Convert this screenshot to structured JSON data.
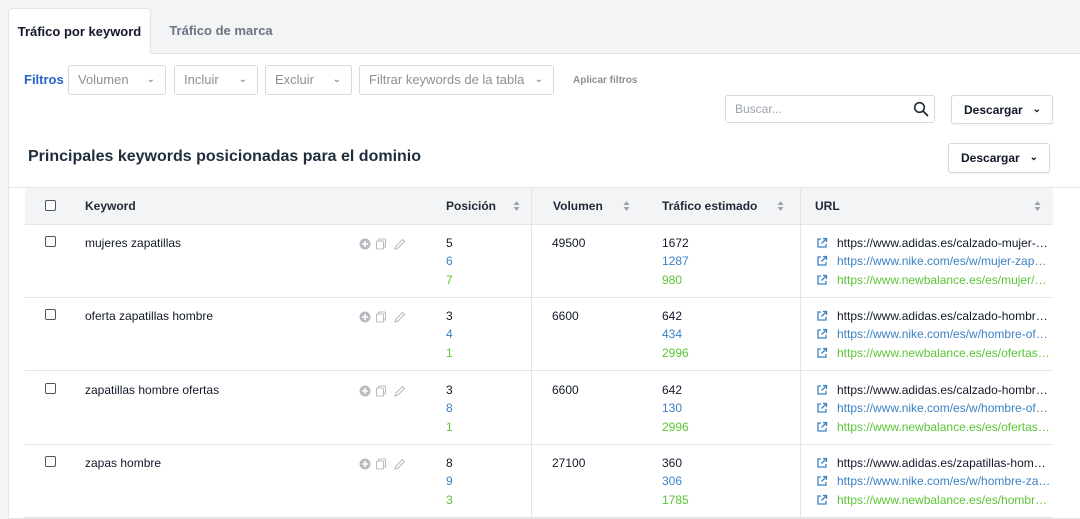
{
  "tabs": [
    {
      "label": "Tráfico por keyword",
      "active": true
    },
    {
      "label": "Tráfico de marca",
      "active": false
    }
  ],
  "filters": {
    "label": "Filtros",
    "selects": [
      "Volumen",
      "Incluir",
      "Excluir",
      "Filtrar keywords de la tabla"
    ],
    "apply": "Aplicar filtros"
  },
  "search": {
    "placeholder": "Buscar..."
  },
  "download": {
    "top": "Descargar",
    "section": "Descargar"
  },
  "section_title": "Principales keywords posicionadas para el dominio",
  "table": {
    "columns": {
      "keyword": "Keyword",
      "position": "Posición",
      "volume": "Volumen",
      "traffic": "Tráfico estimado",
      "url": "URL"
    },
    "rows": [
      {
        "keyword": "mujeres zapatillas",
        "positions": [
          "5",
          "6",
          "7"
        ],
        "volume": "49500",
        "traffic": [
          "1672",
          "1287",
          "980"
        ],
        "urls": [
          "https://www.adidas.es/calzado-mujer-zapatillas",
          "https://www.nike.com/es/w/mujer-zapatillas",
          "https://www.newbalance.es/es/mujer/zapatillas"
        ]
      },
      {
        "keyword": "oferta zapatillas hombre",
        "positions": [
          "3",
          "4",
          "1"
        ],
        "volume": "6600",
        "traffic": [
          "642",
          "434",
          "2996"
        ],
        "urls": [
          "https://www.adidas.es/calzado-hombre-ofertas",
          "https://www.nike.com/es/w/hombre-ofertas-zapatillas",
          "https://www.newbalance.es/es/ofertas/hombre"
        ]
      },
      {
        "keyword": "zapatillas hombre ofertas",
        "positions": [
          "3",
          "8",
          "1"
        ],
        "volume": "6600",
        "traffic": [
          "642",
          "130",
          "2996"
        ],
        "urls": [
          "https://www.adidas.es/calzado-hombre-ofertas",
          "https://www.nike.com/es/w/hombre-ofertas-zapatillas",
          "https://www.newbalance.es/es/ofertas/hombre"
        ]
      },
      {
        "keyword": "zapas hombre",
        "positions": [
          "8",
          "9",
          "3"
        ],
        "volume": "27100",
        "traffic": [
          "360",
          "306",
          "1785"
        ],
        "urls": [
          "https://www.adidas.es/zapatillas-hombre",
          "https://www.nike.com/es/w/hombre-zapatillas",
          "https://www.newbalance.es/es/hombre/zapatillas"
        ]
      }
    ]
  },
  "colors": {
    "primary": "#2563c9",
    "competitor2": "#3b82c4",
    "competitor3": "#5cc536"
  },
  "icons": [
    "search-icon",
    "chevron-down-icon",
    "sort-icon",
    "add-icon",
    "copy-icon",
    "edit-icon",
    "external-link-icon",
    "checkbox-icon"
  ]
}
